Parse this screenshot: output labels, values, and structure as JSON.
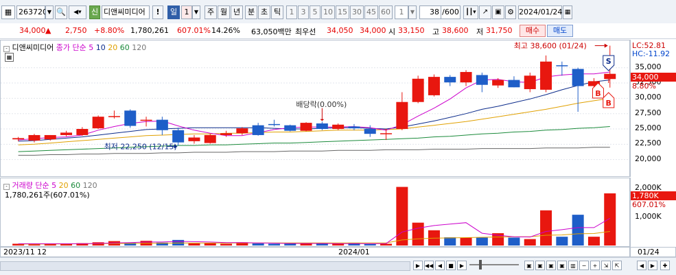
{
  "toolbar": {
    "code": "263720",
    "credit": "신",
    "name": "디앤씨미디어",
    "excl": "!",
    "period_active": "일",
    "period_num": "1",
    "periods": [
      "주",
      "월",
      "년",
      "분",
      "초",
      "틱"
    ],
    "nums": [
      "1",
      "3",
      "5",
      "10",
      "15",
      "30",
      "45",
      "60"
    ],
    "minute_val": "1",
    "count": "38",
    "count_total": "/600",
    "date": "2024/01/24"
  },
  "info": {
    "price": "34,000",
    "change": "2,750",
    "rate": "+8.80%",
    "volume": "1,780,261",
    "vol_rate": "607.01%",
    "turnover": "14.26%",
    "amount": "63,050백만",
    "best_label": "최우선",
    "ask": "34,050",
    "bid": "34,000",
    "open_label": "시",
    "open": "33,150",
    "high_label": "고",
    "high": "38,600",
    "low_label": "저",
    "low": "31,750",
    "sell": "매수",
    "buy": "매도"
  },
  "price_legend": {
    "name": "디앤씨미디어",
    "label": "종가 단순",
    "ma5": "5",
    "ma10": "10",
    "ma20": "20",
    "ma60": "60",
    "ma120": "120"
  },
  "annotations": {
    "high": "최고 38,600 (01/24)",
    "low": "최저 22,250 (12/15)",
    "dividend": "배당락(0.00%)",
    "lc": "LC:52.81",
    "hc": "HC:-11.92",
    "cur_price": "34,000",
    "cur_rate": "8.80%",
    "signal_s": "S",
    "signal_b": "B"
  },
  "volume_legend": {
    "label": "거래량",
    "ma_label": "단순",
    "ma5": "5",
    "ma20": "20",
    "ma60": "60",
    "ma120": "120",
    "value": "1,780,261주(607.01%)",
    "cur_vol": "1,780K",
    "cur_rate": "607.01%"
  },
  "x_labels": [
    "2023/11",
    "12",
    "2024/01"
  ],
  "x_axis_date": "01/24",
  "price_ticks": [
    "35,000",
    "32,500",
    "30,000",
    "27,500",
    "25,000",
    "22,500",
    "20,000"
  ],
  "volume_ticks": [
    "2,000K",
    "1,000K"
  ],
  "colors": {
    "up": "#e8170f",
    "down": "#1e5ec8",
    "ma5": "#cc00cc",
    "ma10": "#0a2a8a",
    "ma20": "#e0a000",
    "ma60": "#1a8a3a",
    "ma120": "#666666"
  },
  "chart_data": {
    "type": "candlestick",
    "y_range": [
      17500,
      39000
    ],
    "volume_range": [
      0,
      2200
    ],
    "volume_unit": "K",
    "candles": [
      {
        "o": 23300,
        "h": 23700,
        "l": 23000,
        "c": 23500
      },
      {
        "o": 23100,
        "h": 24200,
        "l": 22800,
        "c": 24000
      },
      {
        "o": 23300,
        "h": 24000,
        "l": 23100,
        "c": 24000
      },
      {
        "o": 24000,
        "h": 24700,
        "l": 23800,
        "c": 24400
      },
      {
        "o": 24000,
        "h": 25300,
        "l": 23900,
        "c": 25000
      },
      {
        "o": 25100,
        "h": 27200,
        "l": 25000,
        "c": 27000
      },
      {
        "o": 27000,
        "h": 28000,
        "l": 26700,
        "c": 27100
      },
      {
        "o": 28000,
        "h": 28200,
        "l": 25200,
        "c": 25500
      },
      {
        "o": 26500,
        "h": 27000,
        "l": 25400,
        "c": 26500
      },
      {
        "o": 26500,
        "h": 27000,
        "l": 24000,
        "c": 24800
      },
      {
        "o": 24800,
        "h": 25200,
        "l": 22250,
        "c": 22800
      },
      {
        "o": 23000,
        "h": 24000,
        "l": 22600,
        "c": 23600
      },
      {
        "o": 22700,
        "h": 24200,
        "l": 22600,
        "c": 24000
      },
      {
        "o": 24000,
        "h": 24700,
        "l": 23700,
        "c": 24300
      },
      {
        "o": 24300,
        "h": 25300,
        "l": 24000,
        "c": 25100
      },
      {
        "o": 25600,
        "h": 26000,
        "l": 23900,
        "c": 24000
      },
      {
        "o": 25800,
        "h": 26500,
        "l": 25400,
        "c": 25700
      },
      {
        "o": 25600,
        "h": 25700,
        "l": 24600,
        "c": 24700
      },
      {
        "o": 24700,
        "h": 26100,
        "l": 24600,
        "c": 26000
      },
      {
        "o": 25900,
        "h": 26200,
        "l": 24800,
        "c": 25000
      },
      {
        "o": 25000,
        "h": 25900,
        "l": 24800,
        "c": 25700
      },
      {
        "o": 25400,
        "h": 25800,
        "l": 24800,
        "c": 25100
      },
      {
        "o": 25000,
        "h": 25600,
        "l": 23700,
        "c": 24200
      },
      {
        "o": 24200,
        "h": 25000,
        "l": 23200,
        "c": 24300
      },
      {
        "o": 25000,
        "h": 31000,
        "l": 24800,
        "c": 29400
      },
      {
        "o": 29400,
        "h": 33700,
        "l": 29200,
        "c": 33200
      },
      {
        "o": 30500,
        "h": 33900,
        "l": 30300,
        "c": 33500
      },
      {
        "o": 33500,
        "h": 33800,
        "l": 32000,
        "c": 32600
      },
      {
        "o": 32600,
        "h": 34600,
        "l": 32000,
        "c": 34300
      },
      {
        "o": 33800,
        "h": 34200,
        "l": 31000,
        "c": 32200
      },
      {
        "o": 32100,
        "h": 33300,
        "l": 31700,
        "c": 33000
      },
      {
        "o": 33000,
        "h": 33600,
        "l": 31800,
        "c": 31800
      },
      {
        "o": 31500,
        "h": 34200,
        "l": 31000,
        "c": 33700
      },
      {
        "o": 31400,
        "h": 37000,
        "l": 31000,
        "c": 36000
      },
      {
        "o": 35400,
        "h": 36000,
        "l": 33700,
        "c": 35300
      },
      {
        "o": 34800,
        "h": 35000,
        "l": 27800,
        "c": 32000
      },
      {
        "o": 32000,
        "h": 33300,
        "l": 31800,
        "c": 32800
      },
      {
        "o": 33150,
        "h": 38600,
        "l": 31750,
        "c": 34000
      }
    ],
    "volume": [
      60,
      40,
      50,
      70,
      80,
      110,
      150,
      90,
      160,
      100,
      190,
      70,
      80,
      60,
      110,
      70,
      60,
      60,
      70,
      65,
      60,
      80,
      50,
      60,
      2000,
      780,
      520,
      280,
      270,
      270,
      420,
      270,
      220,
      1200,
      300,
      1050,
      300,
      1780
    ],
    "ma5": [
      23200,
      23400,
      23600,
      23700,
      24000,
      24800,
      25400,
      25900,
      26200,
      26300,
      25500,
      24800,
      24300,
      23900,
      23900,
      24400,
      24900,
      25200,
      25300,
      25300,
      25300,
      25400,
      25200,
      24800,
      25700,
      27100,
      28400,
      29900,
      31700,
      33000,
      33100,
      32700,
      32600,
      33500,
      33800,
      34000,
      34000,
      34300
    ],
    "ma10": [
      23000,
      23100,
      23300,
      23500,
      23700,
      24000,
      24300,
      24600,
      24900,
      25000,
      25100,
      25200,
      25200,
      25200,
      25200,
      25200,
      25100,
      25000,
      25000,
      25100,
      25200,
      25200,
      25100,
      25000,
      25300,
      25800,
      26300,
      26900,
      27500,
      28200,
      28700,
      29300,
      29900,
      30600,
      31400,
      32100,
      32700,
      33000
    ],
    "ma20": [
      22400,
      22500,
      22700,
      22900,
      23100,
      23300,
      23500,
      23700,
      23900,
      24000,
      24100,
      24200,
      24200,
      24300,
      24300,
      24400,
      24500,
      24500,
      24600,
      24700,
      24800,
      24800,
      24800,
      24900,
      25000,
      25300,
      25600,
      25900,
      26200,
      26600,
      27000,
      27400,
      27800,
      28200,
      28700,
      29200,
      29600,
      30000
    ],
    "ma60": [
      21300,
      21400,
      21500,
      21600,
      21700,
      21800,
      21900,
      22000,
      22100,
      22200,
      22300,
      22300,
      22400,
      22400,
      22500,
      22600,
      22700,
      22700,
      22800,
      22900,
      23000,
      23100,
      23200,
      23300,
      23400,
      23500,
      23700,
      23800,
      24000,
      24200,
      24300,
      24500,
      24600,
      24800,
      24900,
      25100,
      25200,
      25400
    ],
    "ma120": [
      20700,
      20700,
      20800,
      20800,
      20900,
      20900,
      21000,
      21000,
      21000,
      21100,
      21100,
      21200,
      21200,
      21200,
      21300,
      21300,
      21300,
      21400,
      21400,
      21400,
      21500,
      21500,
      21500,
      21600,
      21600,
      21600,
      21700,
      21700,
      21700,
      21800,
      21800,
      21800,
      21800,
      21900,
      21900,
      21900,
      22000,
      22000
    ],
    "vol_ma5": [
      60,
      60,
      60,
      60,
      60,
      70,
      90,
      100,
      120,
      120,
      140,
      130,
      120,
      100,
      100,
      90,
      80,
      70,
      70,
      70,
      65,
      65,
      65,
      65,
      460,
      590,
      680,
      730,
      780,
      420,
      350,
      300,
      290,
      480,
      540,
      610,
      610,
      930
    ],
    "vol_ma20": [
      50,
      50,
      55,
      55,
      60,
      65,
      70,
      70,
      75,
      80,
      85,
      85,
      85,
      85,
      90,
      90,
      90,
      90,
      90,
      90,
      90,
      90,
      90,
      90,
      190,
      230,
      250,
      260,
      270,
      280,
      290,
      300,
      300,
      350,
      360,
      400,
      410,
      480
    ]
  }
}
